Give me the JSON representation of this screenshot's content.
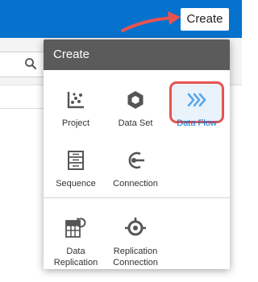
{
  "header": {
    "create_button_label": "Create"
  },
  "menu": {
    "title": "Create",
    "items": [
      {
        "label": "Project",
        "icon": "project-icon"
      },
      {
        "label": "Data Set",
        "icon": "hexagon-icon"
      },
      {
        "label": "Data Flow",
        "icon": "chevrons-right-icon",
        "selected": true
      },
      {
        "label": "Sequence",
        "icon": "sequence-icon"
      },
      {
        "label": "Connection",
        "icon": "plug-icon"
      }
    ],
    "replication_items": [
      {
        "label_line1": "Data",
        "label_line2": "Replication",
        "icon": "grid-refresh-icon"
      },
      {
        "label_line1": "Replication",
        "label_line2": "Connection",
        "icon": "target-icon"
      }
    ]
  },
  "colors": {
    "topbar": "#0572ce",
    "menu_header": "#5b5b5b",
    "highlight": "#e8534f",
    "accent": "#0572ce"
  }
}
